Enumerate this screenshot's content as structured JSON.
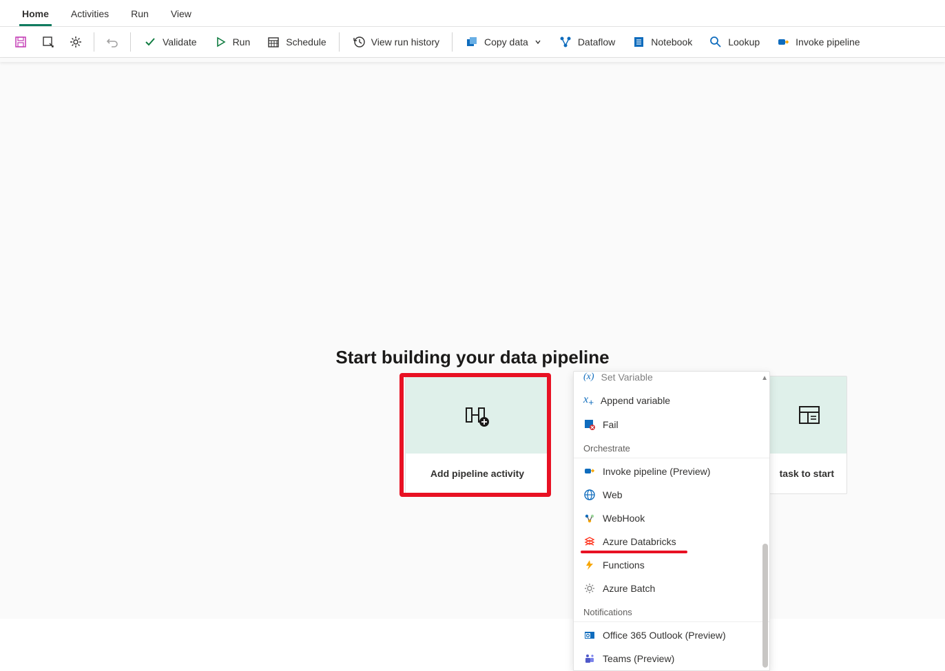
{
  "tabs": [
    "Home",
    "Activities",
    "Run",
    "View"
  ],
  "activeTab": 0,
  "toolbar": {
    "validate": "Validate",
    "run": "Run",
    "schedule": "Schedule",
    "history": "View run history",
    "copydata": "Copy data",
    "dataflow": "Dataflow",
    "notebook": "Notebook",
    "lookup": "Lookup",
    "invoke": "Invoke pipeline"
  },
  "heading": "Start building your data pipeline",
  "cards": {
    "add": "Add pipeline activity",
    "task": "task to start"
  },
  "dropdown": {
    "cutoff": "Set Variable",
    "items_top": [
      {
        "label": "Append variable",
        "iconColor": "#0f6cbd",
        "glyph": "x₊"
      },
      {
        "label": "Fail",
        "iconColor": "#0f6cbd",
        "glyph": "fail"
      }
    ],
    "group_orchestrate": "Orchestrate",
    "items_orchestrate": [
      {
        "label": "Invoke pipeline (Preview)",
        "glyph": "invoke"
      },
      {
        "label": "Web",
        "glyph": "web"
      },
      {
        "label": "WebHook",
        "glyph": "webhook"
      },
      {
        "label": "Azure Databricks",
        "glyph": "databricks"
      },
      {
        "label": "Functions",
        "glyph": "functions"
      },
      {
        "label": "Azure Batch",
        "glyph": "batch"
      }
    ],
    "group_notifications": "Notifications",
    "items_notifications": [
      {
        "label": "Office 365 Outlook (Preview)",
        "glyph": "outlook"
      },
      {
        "label": "Teams (Preview)",
        "glyph": "teams"
      }
    ]
  }
}
